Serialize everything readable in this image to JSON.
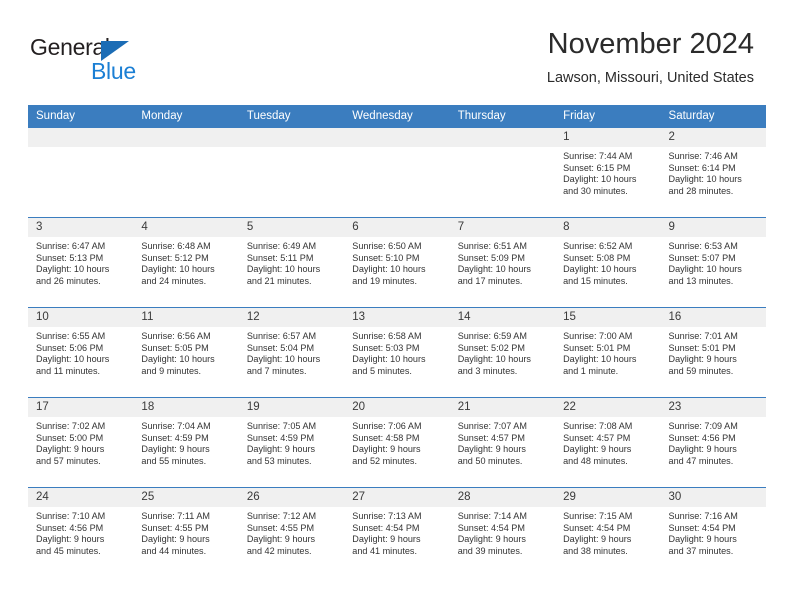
{
  "brand": {
    "name_part1": "General",
    "name_part2": "Blue",
    "logo_icon": "blue-triangle-icon",
    "color_dark": "#231f20",
    "color_blue": "#1b7fd4"
  },
  "header": {
    "title": "November 2024",
    "location": "Lawson, Missouri, United States"
  },
  "theme": {
    "header_bg": "#3b7dbf",
    "daynum_bg": "#f0f0f0",
    "grid_line": "#3b7dbf",
    "text": "#333333"
  },
  "weekday_headers": [
    "Sunday",
    "Monday",
    "Tuesday",
    "Wednesday",
    "Thursday",
    "Friday",
    "Saturday"
  ],
  "labels": {
    "sunrise": "Sunrise:",
    "sunset": "Sunset:",
    "daylight": "Daylight:"
  },
  "weeks": [
    [
      {
        "day": "",
        "empty": true
      },
      {
        "day": "",
        "empty": true
      },
      {
        "day": "",
        "empty": true
      },
      {
        "day": "",
        "empty": true
      },
      {
        "day": "",
        "empty": true
      },
      {
        "day": "1",
        "sunrise": "Sunrise: 7:44 AM",
        "sunset": "Sunset: 6:15 PM",
        "daylight_l1": "Daylight: 10 hours",
        "daylight_l2": "and 30 minutes."
      },
      {
        "day": "2",
        "sunrise": "Sunrise: 7:46 AM",
        "sunset": "Sunset: 6:14 PM",
        "daylight_l1": "Daylight: 10 hours",
        "daylight_l2": "and 28 minutes."
      }
    ],
    [
      {
        "day": "3",
        "sunrise": "Sunrise: 6:47 AM",
        "sunset": "Sunset: 5:13 PM",
        "daylight_l1": "Daylight: 10 hours",
        "daylight_l2": "and 26 minutes."
      },
      {
        "day": "4",
        "sunrise": "Sunrise: 6:48 AM",
        "sunset": "Sunset: 5:12 PM",
        "daylight_l1": "Daylight: 10 hours",
        "daylight_l2": "and 24 minutes."
      },
      {
        "day": "5",
        "sunrise": "Sunrise: 6:49 AM",
        "sunset": "Sunset: 5:11 PM",
        "daylight_l1": "Daylight: 10 hours",
        "daylight_l2": "and 21 minutes."
      },
      {
        "day": "6",
        "sunrise": "Sunrise: 6:50 AM",
        "sunset": "Sunset: 5:10 PM",
        "daylight_l1": "Daylight: 10 hours",
        "daylight_l2": "and 19 minutes."
      },
      {
        "day": "7",
        "sunrise": "Sunrise: 6:51 AM",
        "sunset": "Sunset: 5:09 PM",
        "daylight_l1": "Daylight: 10 hours",
        "daylight_l2": "and 17 minutes."
      },
      {
        "day": "8",
        "sunrise": "Sunrise: 6:52 AM",
        "sunset": "Sunset: 5:08 PM",
        "daylight_l1": "Daylight: 10 hours",
        "daylight_l2": "and 15 minutes."
      },
      {
        "day": "9",
        "sunrise": "Sunrise: 6:53 AM",
        "sunset": "Sunset: 5:07 PM",
        "daylight_l1": "Daylight: 10 hours",
        "daylight_l2": "and 13 minutes."
      }
    ],
    [
      {
        "day": "10",
        "sunrise": "Sunrise: 6:55 AM",
        "sunset": "Sunset: 5:06 PM",
        "daylight_l1": "Daylight: 10 hours",
        "daylight_l2": "and 11 minutes."
      },
      {
        "day": "11",
        "sunrise": "Sunrise: 6:56 AM",
        "sunset": "Sunset: 5:05 PM",
        "daylight_l1": "Daylight: 10 hours",
        "daylight_l2": "and 9 minutes."
      },
      {
        "day": "12",
        "sunrise": "Sunrise: 6:57 AM",
        "sunset": "Sunset: 5:04 PM",
        "daylight_l1": "Daylight: 10 hours",
        "daylight_l2": "and 7 minutes."
      },
      {
        "day": "13",
        "sunrise": "Sunrise: 6:58 AM",
        "sunset": "Sunset: 5:03 PM",
        "daylight_l1": "Daylight: 10 hours",
        "daylight_l2": "and 5 minutes."
      },
      {
        "day": "14",
        "sunrise": "Sunrise: 6:59 AM",
        "sunset": "Sunset: 5:02 PM",
        "daylight_l1": "Daylight: 10 hours",
        "daylight_l2": "and 3 minutes."
      },
      {
        "day": "15",
        "sunrise": "Sunrise: 7:00 AM",
        "sunset": "Sunset: 5:01 PM",
        "daylight_l1": "Daylight: 10 hours",
        "daylight_l2": "and 1 minute."
      },
      {
        "day": "16",
        "sunrise": "Sunrise: 7:01 AM",
        "sunset": "Sunset: 5:01 PM",
        "daylight_l1": "Daylight: 9 hours",
        "daylight_l2": "and 59 minutes."
      }
    ],
    [
      {
        "day": "17",
        "sunrise": "Sunrise: 7:02 AM",
        "sunset": "Sunset: 5:00 PM",
        "daylight_l1": "Daylight: 9 hours",
        "daylight_l2": "and 57 minutes."
      },
      {
        "day": "18",
        "sunrise": "Sunrise: 7:04 AM",
        "sunset": "Sunset: 4:59 PM",
        "daylight_l1": "Daylight: 9 hours",
        "daylight_l2": "and 55 minutes."
      },
      {
        "day": "19",
        "sunrise": "Sunrise: 7:05 AM",
        "sunset": "Sunset: 4:59 PM",
        "daylight_l1": "Daylight: 9 hours",
        "daylight_l2": "and 53 minutes."
      },
      {
        "day": "20",
        "sunrise": "Sunrise: 7:06 AM",
        "sunset": "Sunset: 4:58 PM",
        "daylight_l1": "Daylight: 9 hours",
        "daylight_l2": "and 52 minutes."
      },
      {
        "day": "21",
        "sunrise": "Sunrise: 7:07 AM",
        "sunset": "Sunset: 4:57 PM",
        "daylight_l1": "Daylight: 9 hours",
        "daylight_l2": "and 50 minutes."
      },
      {
        "day": "22",
        "sunrise": "Sunrise: 7:08 AM",
        "sunset": "Sunset: 4:57 PM",
        "daylight_l1": "Daylight: 9 hours",
        "daylight_l2": "and 48 minutes."
      },
      {
        "day": "23",
        "sunrise": "Sunrise: 7:09 AM",
        "sunset": "Sunset: 4:56 PM",
        "daylight_l1": "Daylight: 9 hours",
        "daylight_l2": "and 47 minutes."
      }
    ],
    [
      {
        "day": "24",
        "sunrise": "Sunrise: 7:10 AM",
        "sunset": "Sunset: 4:56 PM",
        "daylight_l1": "Daylight: 9 hours",
        "daylight_l2": "and 45 minutes."
      },
      {
        "day": "25",
        "sunrise": "Sunrise: 7:11 AM",
        "sunset": "Sunset: 4:55 PM",
        "daylight_l1": "Daylight: 9 hours",
        "daylight_l2": "and 44 minutes."
      },
      {
        "day": "26",
        "sunrise": "Sunrise: 7:12 AM",
        "sunset": "Sunset: 4:55 PM",
        "daylight_l1": "Daylight: 9 hours",
        "daylight_l2": "and 42 minutes."
      },
      {
        "day": "27",
        "sunrise": "Sunrise: 7:13 AM",
        "sunset": "Sunset: 4:54 PM",
        "daylight_l1": "Daylight: 9 hours",
        "daylight_l2": "and 41 minutes."
      },
      {
        "day": "28",
        "sunrise": "Sunrise: 7:14 AM",
        "sunset": "Sunset: 4:54 PM",
        "daylight_l1": "Daylight: 9 hours",
        "daylight_l2": "and 39 minutes."
      },
      {
        "day": "29",
        "sunrise": "Sunrise: 7:15 AM",
        "sunset": "Sunset: 4:54 PM",
        "daylight_l1": "Daylight: 9 hours",
        "daylight_l2": "and 38 minutes."
      },
      {
        "day": "30",
        "sunrise": "Sunrise: 7:16 AM",
        "sunset": "Sunset: 4:54 PM",
        "daylight_l1": "Daylight: 9 hours",
        "daylight_l2": "and 37 minutes."
      }
    ]
  ]
}
